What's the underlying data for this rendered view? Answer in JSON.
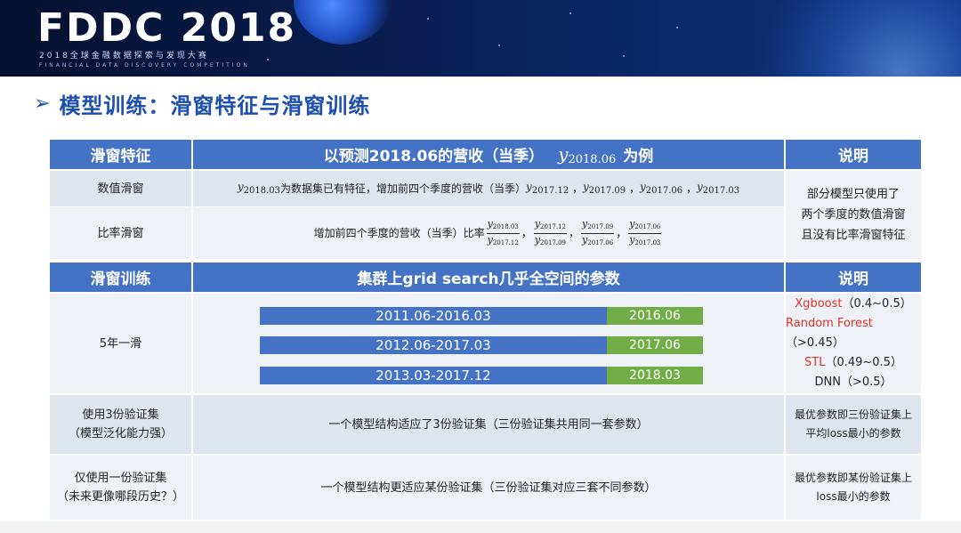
{
  "banner": {
    "logo": "FDDC 2018",
    "subtitle": "2018全球金融数据探索与发现大赛",
    "subtitle_en": "FINANCIAL DATA DISCOVERY COMPETITION"
  },
  "title": {
    "arrow": "➢",
    "text": "模型训练：滑窗特征与滑窗训练"
  },
  "section1": {
    "header_left": "滑窗特征",
    "header_mid_prefix": "以预测2018.06的营收（当季）",
    "header_mid_var": "y",
    "header_mid_sub": "2018.06",
    "header_mid_suffix": "为例",
    "header_right": "说明",
    "rows": [
      {
        "label": "数值滑窗",
        "var": "y",
        "var_sub": "2018.03",
        "text": "为数据集已有特征，增加前四个季度的营收（当季）",
        "terms": [
          "2017.12",
          "2017.09",
          "2017.06",
          "2017.03"
        ]
      },
      {
        "label": "比率滑窗",
        "text": "增加前四个季度的营收（当季）比率",
        "fractions": [
          {
            "num": "2018.03",
            "den": "2017.12"
          },
          {
            "num": "2017.12",
            "den": "2017.09"
          },
          {
            "num": "2017.09",
            "den": "2017.06"
          },
          {
            "num": "2017.06",
            "den": "2017.03"
          }
        ]
      }
    ],
    "note": [
      "部分模型只使用了",
      "两个季度的数值滑窗",
      "且没有比率滑窗特征"
    ]
  },
  "section2": {
    "header_left": "滑窗训练",
    "header_mid": "集群上grid search几乎全空间的参数",
    "header_right": "说明",
    "rows": [
      {
        "label": "5年一滑",
        "bars": [
          {
            "train": "2011.06-2016.03",
            "val": "2016.06"
          },
          {
            "train": "2012.06-2017.03",
            "val": "2017.06"
          },
          {
            "train": "2013.03-2017.12",
            "val": "2018.03"
          }
        ],
        "notes": [
          {
            "name": "Xgboost",
            "range": "（0.4~0.5）",
            "highlight": true
          },
          {
            "name": "Random Forest",
            "range": "（>0.45）",
            "highlight": true
          },
          {
            "name": "STL",
            "range": "（0.49~0.5）",
            "highlight": true
          },
          {
            "name": "DNN",
            "range": "（>0.5）",
            "highlight": false
          }
        ]
      },
      {
        "label_lines": [
          "使用3份验证集",
          "（模型泛化能力强）"
        ],
        "desc": "一个模型结构适应了3份验证集（三份验证集共用同一套参数）",
        "note_lines": [
          "最优参数即三份验证集上",
          "平均loss最小的参数"
        ]
      },
      {
        "label_lines": [
          "仅使用一份验证集",
          "（未来更像哪段历史？）"
        ],
        "desc": "一个模型结构更适应某份验证集（三份验证集对应三套不同参数）",
        "note_lines": [
          "最优参数即某份验证集上",
          "loss最小的参数"
        ]
      }
    ]
  },
  "colors": {
    "header_blue": "#4472c4",
    "val_green": "#70ad47",
    "title_blue": "#1d4fb0",
    "highlight_red": "#e0312b"
  }
}
